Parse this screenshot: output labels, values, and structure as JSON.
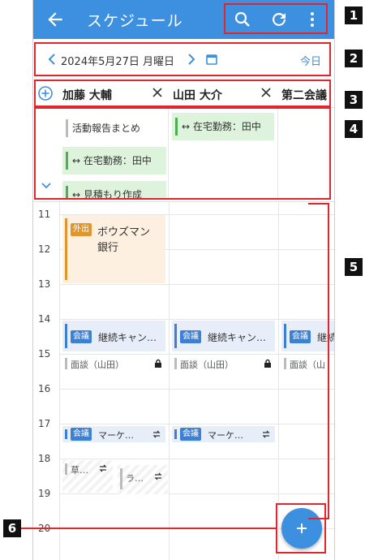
{
  "appbar": {
    "title": "スケジュール",
    "icons": [
      "back-arrow-icon",
      "search-icon",
      "refresh-icon",
      "more-vert-icon"
    ],
    "color": "#3d8fe0"
  },
  "datebar": {
    "date": "2024年5月27日 月曜日",
    "today_label": "今日"
  },
  "users": [
    {
      "name": "加藤 大輔"
    },
    {
      "name": "山田 大介"
    },
    {
      "name": "第二会議"
    }
  ],
  "allday": {
    "col1": [
      {
        "label": "活動報告まとめ",
        "kind": "gray"
      },
      {
        "label": "↔ 在宅勤務：田中",
        "kind": "green"
      },
      {
        "label": "↔ 見積もり作成",
        "kind": "green"
      }
    ],
    "col2": [
      {
        "label": "↔ 在宅勤務：田中",
        "kind": "green"
      }
    ]
  },
  "hours": [
    "11",
    "12",
    "13",
    "14",
    "15",
    "16",
    "17",
    "18",
    "19",
    "20"
  ],
  "events": {
    "gaishutsu_tag": "外出",
    "gaishutsu_title": "ボウズマン",
    "gaishutsu_title2": "銀行",
    "kaigi_tag": "会議",
    "keizoku_title": "継続キャン…",
    "keizoku_title_short": "継続",
    "mendan": "面談（山田）",
    "mendan_short": "面談（山",
    "marketing": "マーケ…",
    "short1": "草…",
    "short2": "ラ…"
  },
  "callouts": [
    "1",
    "2",
    "3",
    "4",
    "5",
    "6"
  ],
  "colors": {
    "accent": "#3d8fe0",
    "callout": "#e0262c",
    "green": "#4caf50",
    "orange": "#e0962c",
    "meeting": "#3d7fd0"
  }
}
